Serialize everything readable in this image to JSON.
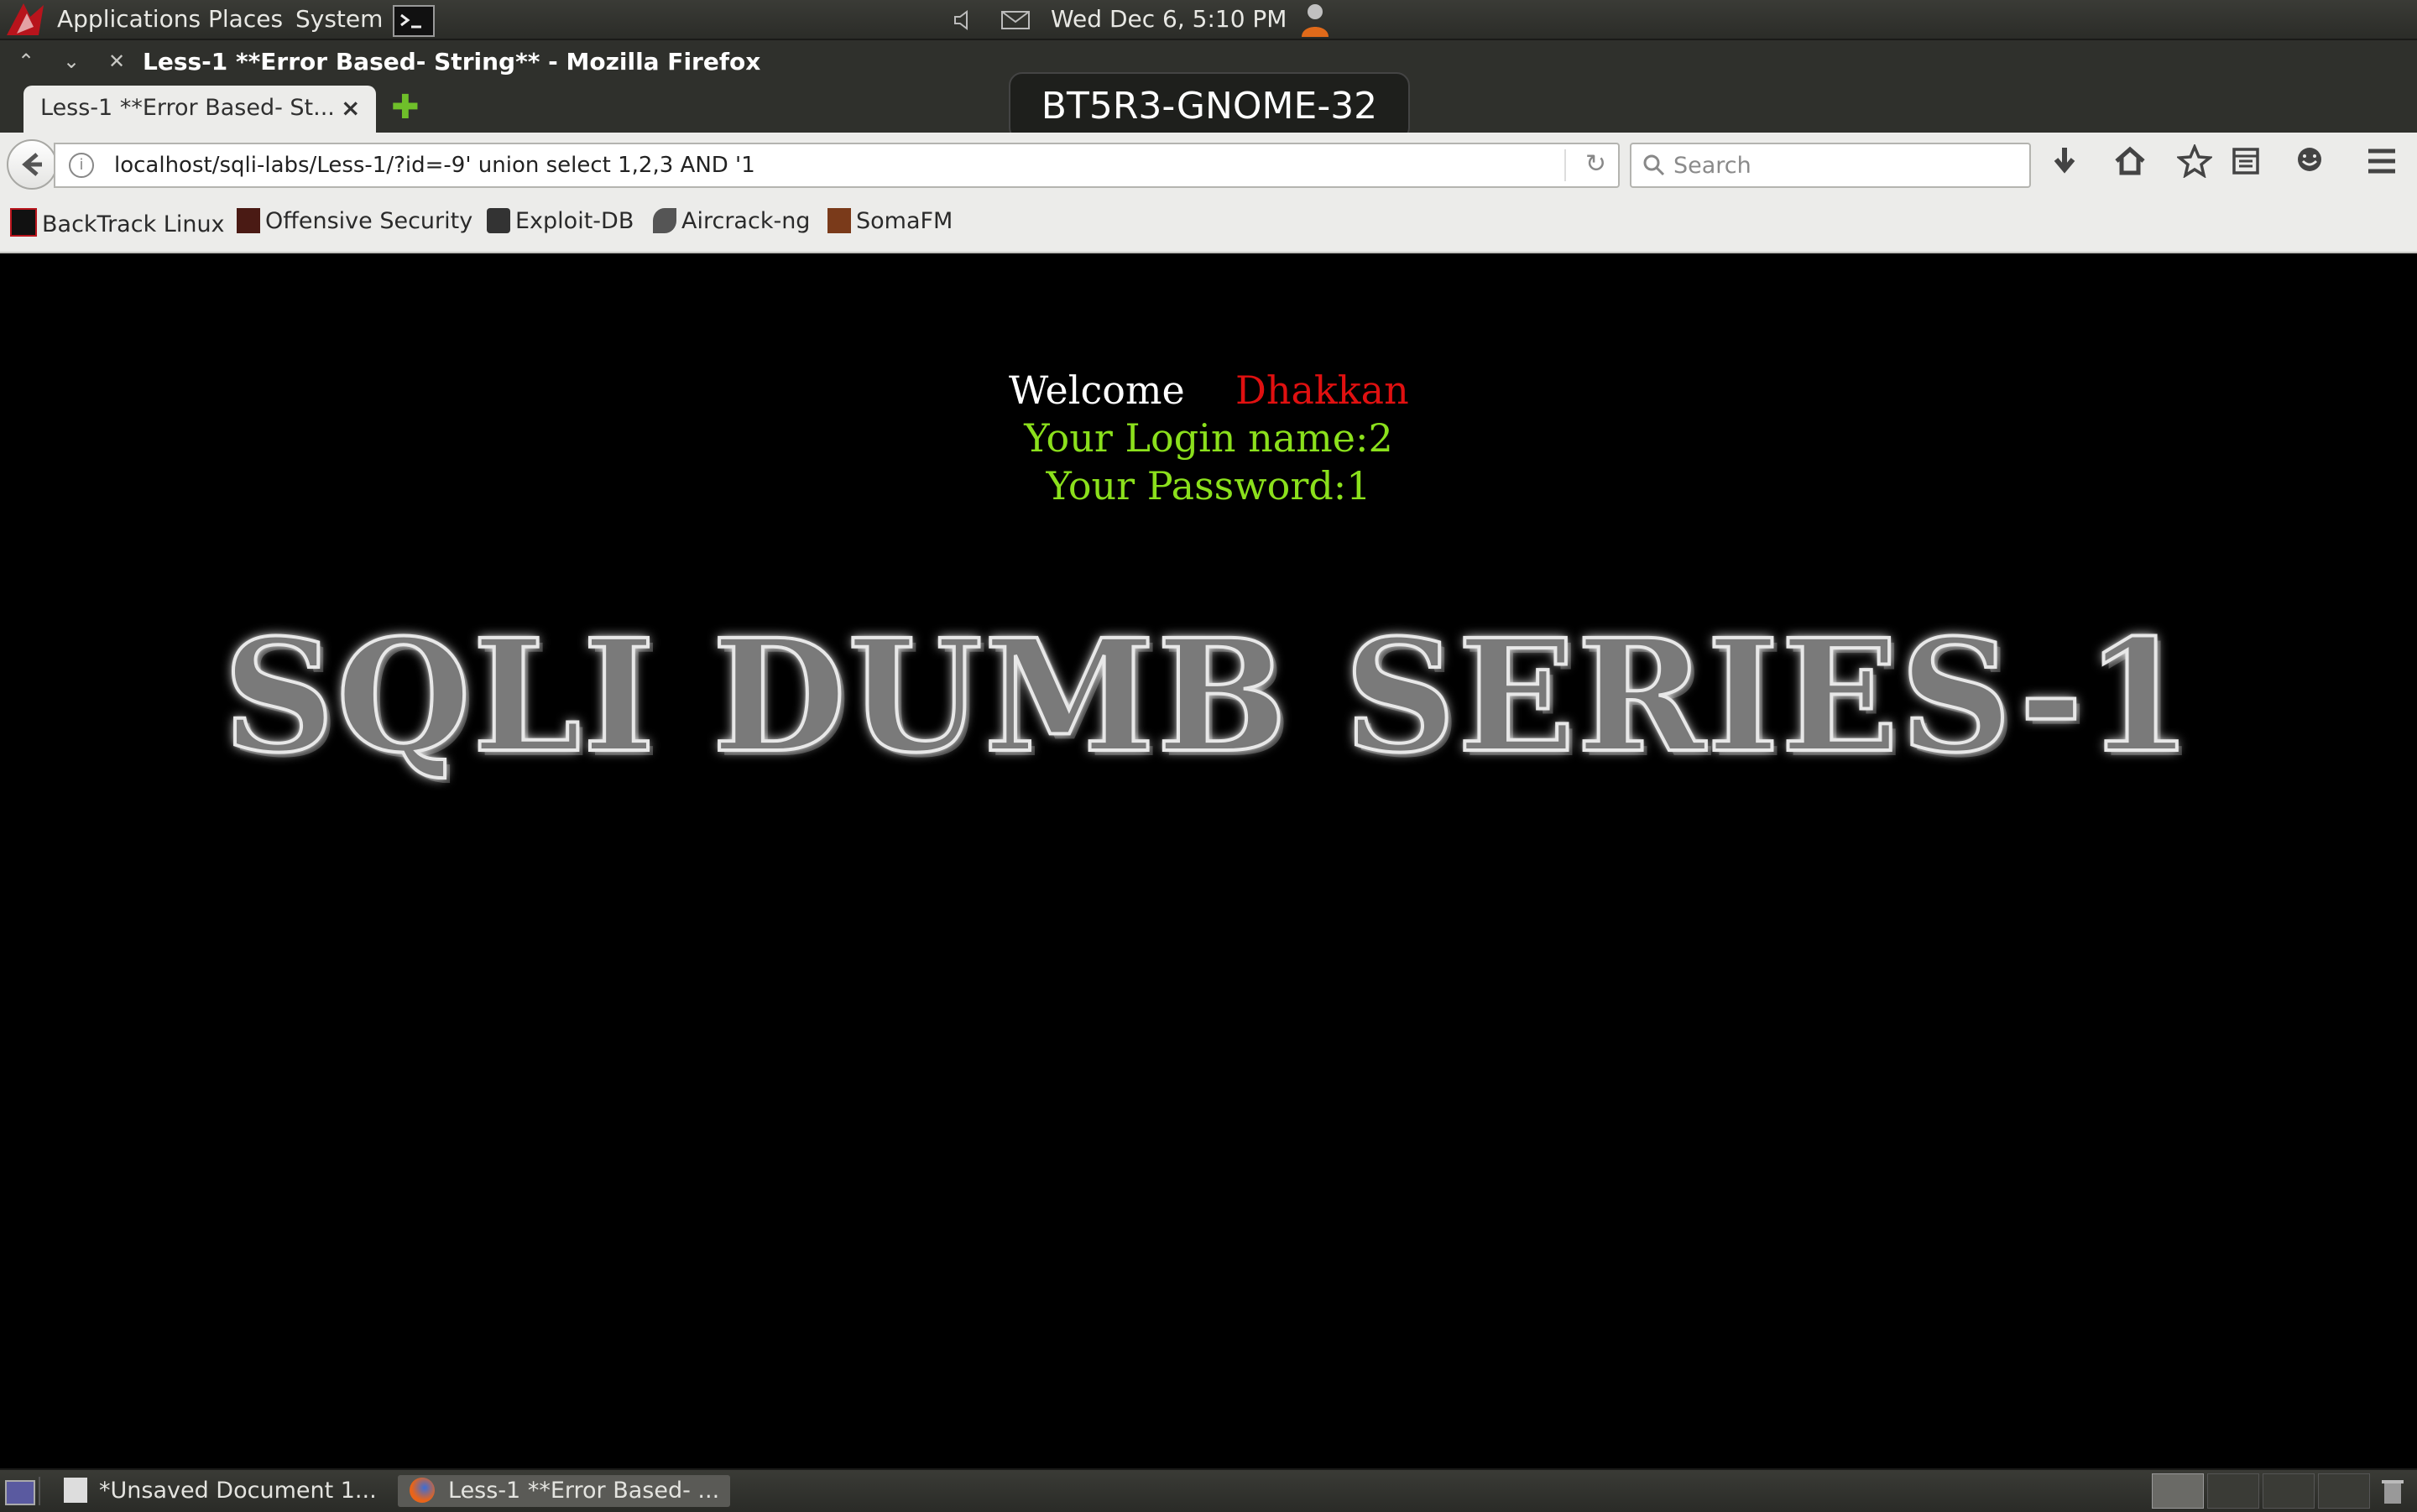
{
  "panel": {
    "applications": "Applications",
    "places": "Places",
    "system": "System",
    "clock": "Wed Dec  6,  5:10 PM"
  },
  "window": {
    "title": "Less-1 **Error Based- String** - Mozilla Firefox",
    "hostname_badge": "BT5R3-GNOME-32"
  },
  "tabs": [
    {
      "label": "Less-1 **Error Based- St...",
      "close": "×"
    }
  ],
  "navbar": {
    "url": "localhost/sqli-labs/Less-1/?id=-9' union select 1,2,3 AND '1",
    "search_placeholder": "Search"
  },
  "bookmarks": [
    {
      "label": "BackTrack Linux"
    },
    {
      "label": "Offensive Security"
    },
    {
      "label": "Exploit-DB"
    },
    {
      "label": "Aircrack-ng"
    },
    {
      "label": "SomaFM"
    }
  ],
  "content": {
    "welcome": "Welcome",
    "name": "Dhakkan",
    "login_line": "Your Login name:2",
    "password_line": "Your Password:1",
    "banner": "SQLI DUMB SERIES-1"
  },
  "taskbar": {
    "items": [
      {
        "label": "*Unsaved Document 1..."
      },
      {
        "label": "Less-1 **Error Based- ..."
      }
    ]
  },
  "colors": {
    "welcome_name": "#e01010",
    "login_text": "#8be01c",
    "page_background": "#000000"
  }
}
